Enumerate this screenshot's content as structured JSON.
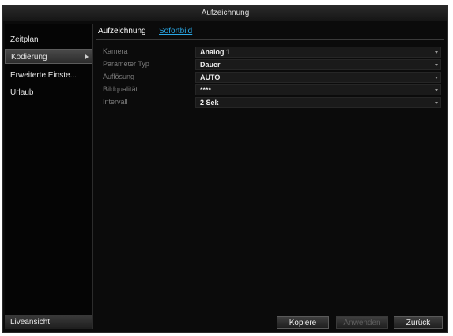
{
  "window": {
    "title": "Aufzeichnung"
  },
  "sidebar": {
    "items": [
      {
        "label": "Zeitplan",
        "active": false
      },
      {
        "label": "Kodierung",
        "active": true
      },
      {
        "label": "Erweiterte Einste...",
        "active": false
      },
      {
        "label": "Urlaub",
        "active": false
      }
    ],
    "live_button": "Liveansicht"
  },
  "tabs": [
    {
      "label": "Aufzeichnung",
      "active": true
    },
    {
      "label": "Sofortbild",
      "active": false
    }
  ],
  "form": {
    "rows": [
      {
        "label": "Kamera",
        "value": "Analog 1"
      },
      {
        "label": "Parameter Typ",
        "value": "Dauer"
      },
      {
        "label": "Auflösung",
        "value": "AUTO"
      },
      {
        "label": "Bildqualität",
        "value": "****"
      },
      {
        "label": "Intervall",
        "value": "2 Sek"
      }
    ]
  },
  "buttons": {
    "copy": "Kopiere",
    "apply": "Anwenden",
    "back": "Zurück"
  },
  "colors": {
    "background": "#0b0b0b",
    "link": "#2aa8e6",
    "label_dim": "#7a7a7a"
  }
}
